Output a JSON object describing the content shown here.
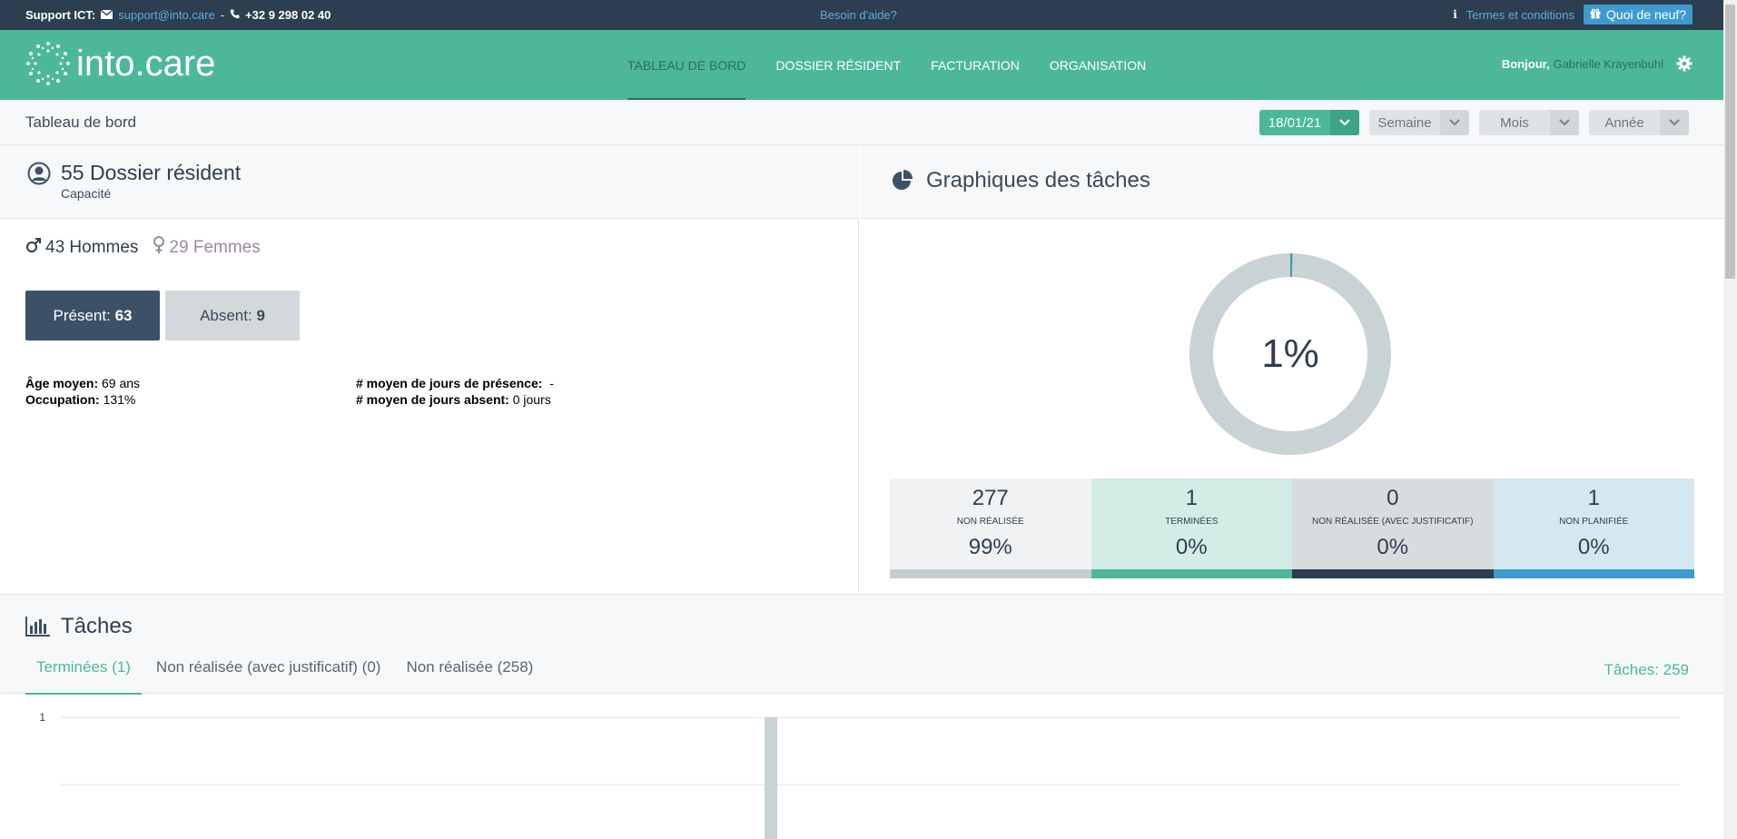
{
  "topbar": {
    "support_label": "Support ICT:",
    "email": "support@into.care",
    "separator": "-",
    "phone": "+32 9 298 02 40",
    "help": "Besoin d'aide?",
    "terms": "Termes et conditions",
    "news": "Quoi de neuf?"
  },
  "header": {
    "logo_text": "into.care",
    "nav": [
      {
        "label": "TABLEAU DE BORD",
        "active": true
      },
      {
        "label": "DOSSIER RÉSIDENT",
        "active": false
      },
      {
        "label": "FACTURATION",
        "active": false
      },
      {
        "label": "ORGANISATION",
        "active": false
      }
    ],
    "greeting": "Bonjour,",
    "user_name": "Gabrielle Krayenbuhl"
  },
  "subheader": {
    "title": "Tableau de bord",
    "date": "18/01/21",
    "week": "Semaine",
    "month": "Mois",
    "year": "Année"
  },
  "residents": {
    "title": "55 Dossier résident",
    "subtitle": "Capacité",
    "men": "43 Hommes",
    "women": "29 Femmes",
    "present_label": "Présent:",
    "present_value": "63",
    "absent_label": "Absent:",
    "absent_value": "9",
    "avg_age_label": "Âge moyen:",
    "avg_age_value": "69 ans",
    "occupation_label": "Occupation:",
    "occupation_value": "131%",
    "avg_presence_label": "# moyen de jours de présence:",
    "avg_presence_value": "-",
    "avg_absent_label": "# moyen de jours absent:",
    "avg_absent_value": "0 jours"
  },
  "task_charts": {
    "title": "Graphiques des tâches",
    "donut_percent": "1%",
    "donut_fill": 0.0036,
    "cells": [
      {
        "num": "277",
        "label": "NON RÉALISÉE",
        "percent": "99%",
        "bg": "#f0f2f3",
        "bar": "#c5cdd0"
      },
      {
        "num": "1",
        "label": "TERMINÉES",
        "percent": "0%",
        "bg": "#d4ece6",
        "bar": "#4cb899"
      },
      {
        "num": "0",
        "label": "NON RÉALISÉE (AVEC JUSTIFICATIF)",
        "percent": "0%",
        "bg": "#d8dcdf",
        "bar": "#2c3e50"
      },
      {
        "num": "1",
        "label": "NON PLANIFIÉE",
        "percent": "0%",
        "bg": "#d5e8ef",
        "bar": "#3d9bd0"
      }
    ]
  },
  "tasks": {
    "title": "Tâches",
    "tabs": [
      {
        "label": "Terminées (1)",
        "active": true
      },
      {
        "label": "Non réalisée (avec justificatif) (0)",
        "active": false
      },
      {
        "label": "Non réalisée (258)",
        "active": false
      }
    ],
    "total": "Tâches: 259"
  },
  "chart_data": {
    "type": "bar",
    "ytick_labels": [
      "1"
    ],
    "ylim": [
      0,
      2
    ],
    "series": [
      {
        "values": [
          1
        ]
      }
    ]
  },
  "colors": {
    "brand_green": "#4cb899",
    "dark_navy": "#2c3e50",
    "link_blue": "#5dade2"
  }
}
